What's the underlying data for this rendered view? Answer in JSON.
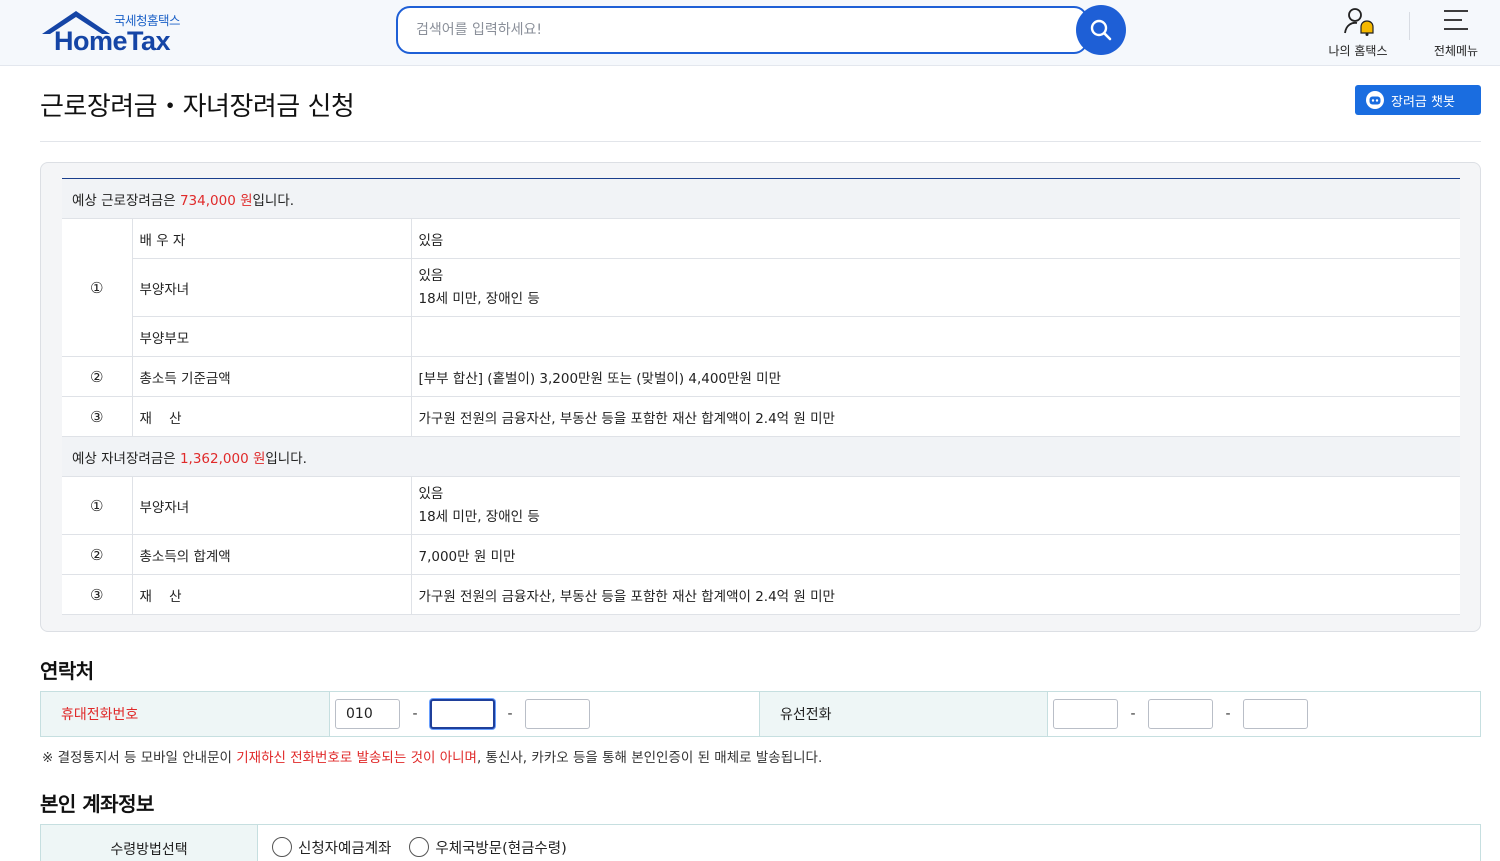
{
  "header": {
    "logo_sub": "국세청홈택스",
    "logo_main": "HomeTax",
    "search_placeholder": "검색어를 입력하세요!",
    "my_hometax_label": "나의 홈택스",
    "all_menu_label": "전체메뉴"
  },
  "page": {
    "title": "근로장려금・자녀장려금 신청",
    "chatbot_label": "장려금 챗봇"
  },
  "work_incentive": {
    "prefix": "예상 근로장려금은 ",
    "amount": "734,000 원",
    "suffix": "입니다.",
    "rows": [
      {
        "num": "①",
        "item": "배 우 자",
        "value": "있음",
        "value2": ""
      },
      {
        "num": "",
        "item": "부양자녀",
        "value": "있음",
        "value2": "18세 미만, 장애인 등"
      },
      {
        "num": "",
        "item": "부양부모",
        "value": "",
        "value2": ""
      },
      {
        "num": "②",
        "item": "총소득 기준금액",
        "value": "[부부 합산] (홑벌이) 3,200만원 또는 (맞벌이) 4,400만원 미만",
        "value2": ""
      },
      {
        "num": "③",
        "item": "재    산",
        "value": "가구원 전원의 금융자산, 부동산 등을 포함한 재산 합계액이 2.4억 원 미만",
        "value2": ""
      }
    ]
  },
  "child_incentive": {
    "prefix": "예상 자녀장려금은 ",
    "amount": "1,362,000 원",
    "suffix": "입니다.",
    "rows": [
      {
        "num": "①",
        "item": "부양자녀",
        "value": "있음",
        "value2": "18세 미만, 장애인 등"
      },
      {
        "num": "②",
        "item": "총소득의 합계액",
        "value": "7,000만 원 미만",
        "value2": ""
      },
      {
        "num": "③",
        "item": "재    산",
        "value": "가구원 전원의 금융자산, 부동산 등을 포함한 재산 합계액이 2.4억 원 미만",
        "value2": ""
      }
    ]
  },
  "contact": {
    "section_title": "연락처",
    "mobile_label": "휴대전화번호",
    "mobile_first": "010",
    "mobile_mid": "",
    "mobile_last": "",
    "landline_label": "유선전화",
    "landline_1": "",
    "landline_2": "",
    "landline_3": "",
    "dash": "-",
    "notice_prefix": "※ 결정통지서 등 모바일 안내문이 ",
    "notice_red": "기재하신 전화번호로 발송되는 것이 아니며",
    "notice_suffix": ", 통신사, 카카오 등을 통해 본인인증이 된 매체로 발송됩니다."
  },
  "account": {
    "section_title": "본인 계좌정보",
    "method_label": "수령방법선택",
    "option_bank": "신청자예금계좌",
    "option_post": "우체국방문(현금수령)"
  },
  "colors": {
    "primary": "#1e5fd6",
    "accent_red": "#e02a2a",
    "label_bg": "#eef6f6"
  }
}
